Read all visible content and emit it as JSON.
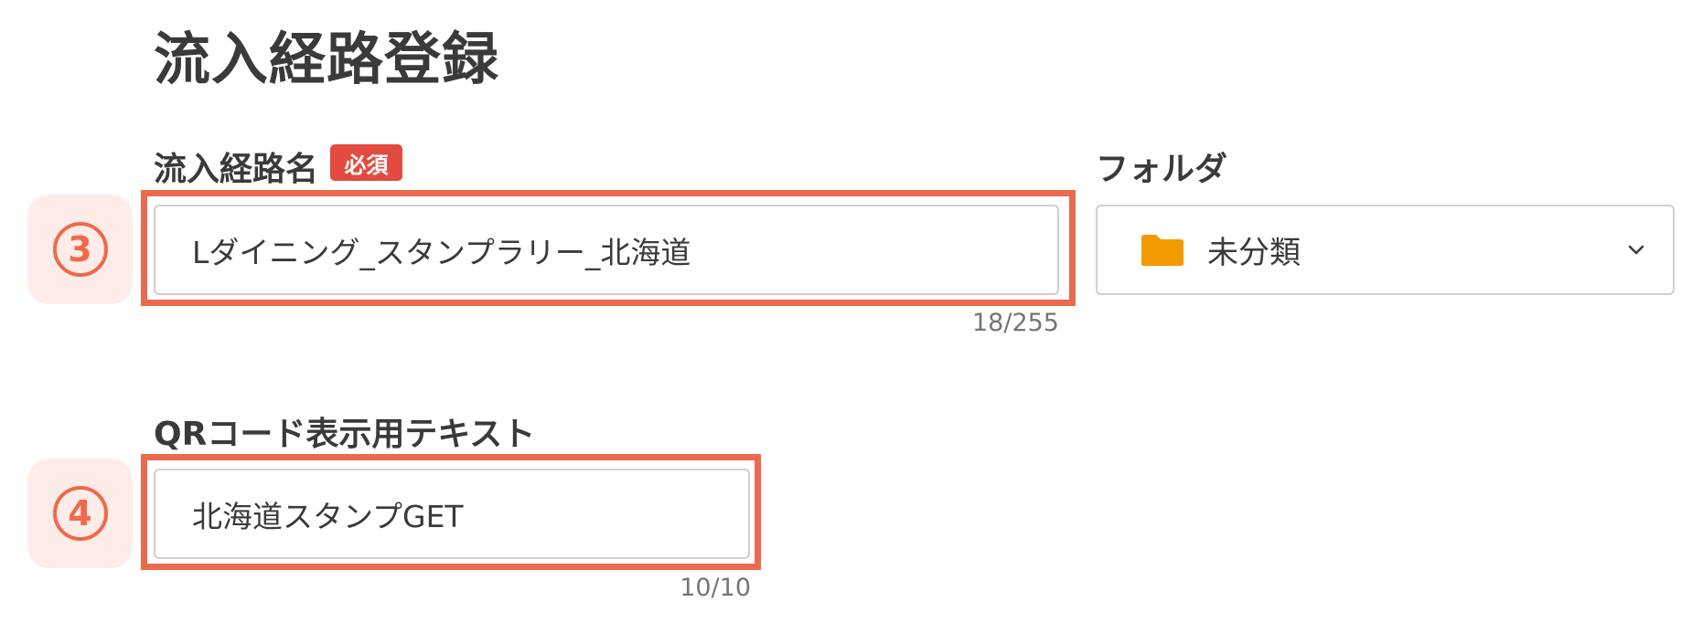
{
  "page": {
    "title": "流入経路登録"
  },
  "route_name": {
    "label": "流入経路名",
    "required_badge": "必須",
    "step_marker": "3",
    "value": "Lダイニング_スタンプラリー_北海道",
    "char_count": "18/255"
  },
  "folder": {
    "label": "フォルダ",
    "selected_value": "未分類",
    "icon": "folder-icon",
    "icon_color": "#f39a00"
  },
  "qr_text": {
    "label": "QRコード表示用テキスト",
    "step_marker": "4",
    "value": "北海道スタンプGET",
    "char_count": "10/10"
  },
  "colors": {
    "accent": "#ea6a4f",
    "required_badge": "#e24b3f",
    "marker_background": "#fdece8",
    "text": "#3a3a3a"
  }
}
